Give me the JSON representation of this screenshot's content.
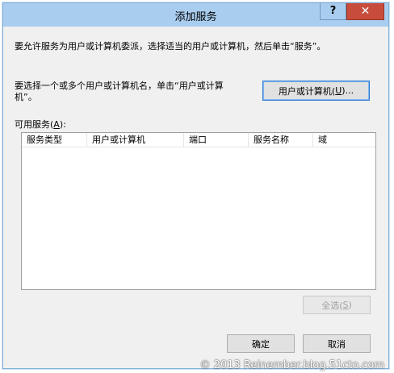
{
  "window": {
    "title": "添加服务",
    "help_label": "?",
    "close_label": "✕"
  },
  "description": "要允许服务为用户或计算机委派，选择适当的用户或计算机，然后单击“服务”。",
  "select_prompt": {
    "line1": "要选择一个或多个用户或计算机名，单击“用户或计算",
    "line2": "机”。"
  },
  "users_button": {
    "label": "用户或计算机(",
    "accel": "U",
    "suffix": ")..."
  },
  "available_services": {
    "label": "可用服务(",
    "accel": "A",
    "suffix": "):"
  },
  "table": {
    "columns": [
      "服务类型",
      "用户或计算机",
      "端口",
      "服务名称",
      "域"
    ],
    "rows": []
  },
  "select_all_button": {
    "label": "全选(",
    "accel": "S",
    "suffix": ")"
  },
  "ok_button": "确定",
  "cancel_button": "取消",
  "watermark": "© 2013 Reinember.blog.51cto.com",
  "colors": {
    "titlebar": "#a9cdee",
    "close": "#c74c3c",
    "dialog_bg": "#f0f0f0",
    "default_button_border": "#2f7bd4"
  }
}
